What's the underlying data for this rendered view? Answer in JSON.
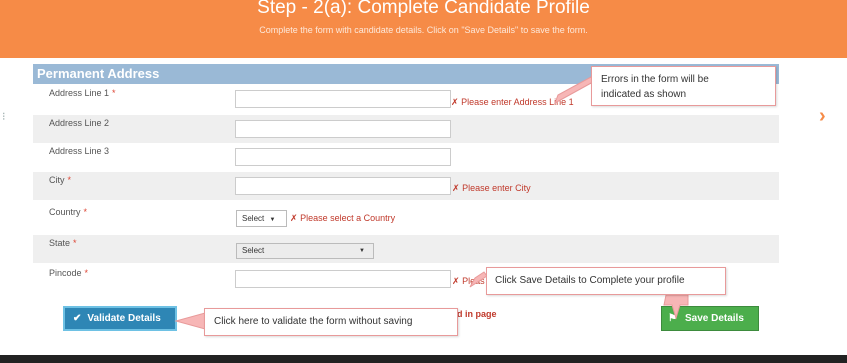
{
  "header": {
    "title": "Step - 2(a): Complete Candidate Profile",
    "subtitle": "Complete the form with candidate details. Click on \"Save Details\" to save the form."
  },
  "section": {
    "title": "Permanent Address"
  },
  "form": {
    "required_mark": "*",
    "address1": {
      "label": "Address Line 1",
      "error": "Please enter Address Line 1"
    },
    "address2": {
      "label": "Address Line 2"
    },
    "address3": {
      "label": "Address Line 3"
    },
    "city": {
      "label": "City",
      "error": "Please enter City"
    },
    "country": {
      "label": "Country",
      "selected": "Select",
      "error": "Please select a Country"
    },
    "state": {
      "label": "State",
      "selected": "Select"
    },
    "pincode": {
      "label": "Pincode",
      "error_fragment": "Pleas"
    },
    "page_error_fragment": "d in page"
  },
  "buttons": {
    "validate_label": "Validate Details",
    "save_label": "Save Details"
  },
  "callouts": {
    "errors_line1": "Errors in the form will be",
    "errors_line2": "indicated as shown",
    "save": "Click Save Details to Complete your profile",
    "validate": "Click here to validate the form without saving"
  },
  "icons": {
    "error": "✗",
    "check": "✔",
    "flag": "⚑",
    "dropdown": "▼",
    "next": "›"
  },
  "colors": {
    "header_bg": "#f68b47",
    "section_header_bg": "#9ab9d6",
    "validate_btn": "#2e86b5",
    "save_btn": "#4cae4c",
    "error_text": "#c0392b"
  }
}
